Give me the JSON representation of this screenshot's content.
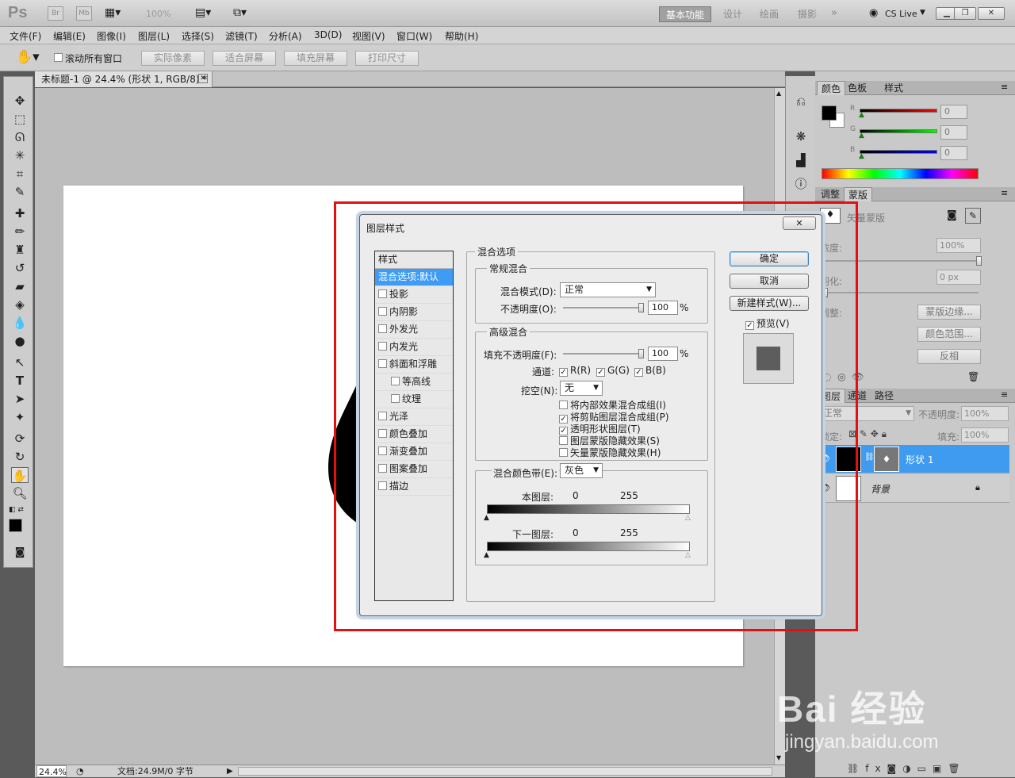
{
  "app": {
    "logo": "Ps",
    "bridge": "Br",
    "mini_bridge": "Mb",
    "zoom": "100%"
  },
  "workspaces": [
    "基本功能",
    "设计",
    "绘画",
    "摄影"
  ],
  "cs_live": "CS Live",
  "menu": [
    "文件(F)",
    "编辑(E)",
    "图像(I)",
    "图层(L)",
    "选择(S)",
    "滤镜(T)",
    "分析(A)",
    "3D(D)",
    "视图(V)",
    "窗口(W)",
    "帮助(H)"
  ],
  "options": {
    "scroll_all": "滚动所有窗口",
    "buttons": [
      "实际像素",
      "适合屏幕",
      "填充屏幕",
      "打印尺寸"
    ]
  },
  "document": {
    "tab_title": "未标题-1 @ 24.4% (形状 1, RGB/8) *",
    "zoom": "24.4%",
    "doc_info": "文档:24.9M/0 字节"
  },
  "color_panel": {
    "tabs": [
      "颜色",
      "色板",
      "样式"
    ],
    "channels": [
      {
        "label": "R",
        "value": "0",
        "color": "#ff0000"
      },
      {
        "label": "G",
        "value": "0",
        "color": "#00ff00"
      },
      {
        "label": "B",
        "value": "0",
        "color": "#0000ff"
      }
    ]
  },
  "mask_panel": {
    "tabs": [
      "调整",
      "蒙版"
    ],
    "title": "矢量蒙版",
    "density_label": "浓度:",
    "density": "100%",
    "feather_label": "羽化:",
    "feather": "0 px",
    "refine_label": "调整:",
    "buttons": [
      "蒙版边缘...",
      "颜色范围...",
      "反相"
    ]
  },
  "layers_panel": {
    "tabs": [
      "图层",
      "通道",
      "路径"
    ],
    "blend_mode": "正常",
    "opacity_label": "不透明度:",
    "opacity": "100%",
    "lock_label": "锁定:",
    "fill_label": "填充:",
    "fill": "100%",
    "layers": [
      {
        "name": "形状 1",
        "selected": true
      },
      {
        "name": "背景",
        "selected": false
      }
    ]
  },
  "dialog": {
    "title": "图层样式",
    "close": "✕",
    "styles_header": "样式",
    "styles": [
      {
        "label": "混合选项:默认",
        "checkbox": false,
        "active": true,
        "indent": false
      },
      {
        "label": "投影",
        "checkbox": true,
        "indent": false
      },
      {
        "label": "内阴影",
        "checkbox": true,
        "indent": false
      },
      {
        "label": "外发光",
        "checkbox": true,
        "indent": false
      },
      {
        "label": "内发光",
        "checkbox": true,
        "indent": false
      },
      {
        "label": "斜面和浮雕",
        "checkbox": true,
        "indent": false
      },
      {
        "label": "等高线",
        "checkbox": true,
        "indent": true
      },
      {
        "label": "纹理",
        "checkbox": true,
        "indent": true
      },
      {
        "label": "光泽",
        "checkbox": true,
        "indent": false
      },
      {
        "label": "颜色叠加",
        "checkbox": true,
        "indent": false
      },
      {
        "label": "渐变叠加",
        "checkbox": true,
        "indent": false
      },
      {
        "label": "图案叠加",
        "checkbox": true,
        "indent": false
      },
      {
        "label": "描边",
        "checkbox": true,
        "indent": false
      }
    ],
    "blend_options_title": "混合选项",
    "general_title": "常规混合",
    "blend_mode_label": "混合模式(D):",
    "blend_mode": "正常",
    "opacity_label": "不透明度(O):",
    "opacity": "100",
    "pct": "%",
    "advanced_title": "高级混合",
    "fill_opacity_label": "填充不透明度(F):",
    "fill_opacity": "100",
    "channels_label": "通道:",
    "channels": [
      "R(R)",
      "G(G)",
      "B(B)"
    ],
    "knockout_label": "挖空(N):",
    "knockout": "无",
    "advanced_options": [
      {
        "label": "将内部效果混合成组(I)",
        "checked": false
      },
      {
        "label": "将剪贴图层混合成组(P)",
        "checked": true
      },
      {
        "label": "透明形状图层(T)",
        "checked": true
      },
      {
        "label": "图层蒙版隐藏效果(S)",
        "checked": false
      },
      {
        "label": "矢量蒙版隐藏效果(H)",
        "checked": false
      }
    ],
    "blend_if_label": "混合颜色带(E):",
    "blend_if": "灰色",
    "this_layer_label": "本图层:",
    "underlying_label": "下一图层:",
    "range_min": "0",
    "range_max": "255",
    "buttons": {
      "ok": "确定",
      "cancel": "取消",
      "new_style": "新建样式(W)..."
    },
    "preview_label": "预览(V)"
  },
  "watermark": {
    "brand": "Bai 经验",
    "url": "jingyan.baidu.com"
  }
}
